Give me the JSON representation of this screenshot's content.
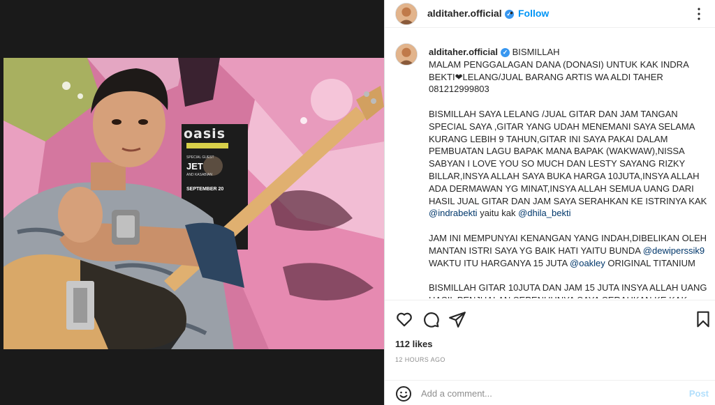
{
  "post": {
    "username": "alditaher.official",
    "verified_icon": "verified-badge-icon",
    "separator": "•",
    "follow_label": "Follow",
    "more_icon": "more-options-icon"
  },
  "media": {
    "poster_band": "oasis",
    "poster_small_1": "SPECIAL GUEST",
    "poster_act": "JET",
    "poster_small_2": "AND KASABIAN",
    "poster_date": "SEPTEMBER 20"
  },
  "caption": {
    "username": "alditaher.official",
    "paragraphs": [
      "BISMILLAH\nMALAM PENGGALAGAN DANA (DONASI) UNTUK KAK INDRA BEKTI❤LELANG/JUAL BARANG ARTIS WA ALDI TAHER 081212999803",
      "BISMILLAH SAYA LELANG /JUAL GITAR DAN JAM TANGAN SPECIAL SAYA ,GITAR YANG UDAH MENEMANI SAYA SELAMA KURANG LEBIH 9 TAHUN,GITAR INI SAYA PAKAI DALAM PEMBUATAN LAGU BAPAK MANA BAPAK (WAKWAW),NISSA SABYAN I LOVE YOU SO MUCH DAN LESTY SAYANG RIZKY BILLAR,INSYA ALLAH SAYA BUKA HARGA 10JUTA,INSYA ALLAH ADA DERMAWAN YG MINAT,INSYA ALLAH SEMUA UANG DARI HASIL JUAL GITAR DAN JAM SAYA SERAHKAN KE ISTRINYA KAK",
      "JAM INI MEMPUNYAI KENANGAN YANG INDAH,DIBELIKAN OLEH MANTAN ISTRI SAYA YG BAIK HATI YAITU BUNDA",
      "BISMILLAH GITAR 10JUTA DAN JAM 15 JUTA INSYA ALLAH UANG HASIL PENJUALAN SEPENUHNYA SAYA SERAHKAN KE KAK"
    ],
    "mention_1": "@indrabekti",
    "joiner_1": " yaitu kak ",
    "mention_2": "@dhila_bekti",
    "mention_3": "@dewiperssik9",
    "after_mention_3": "\nWAKTU ITU HARGANYA 15 JUTA ",
    "mention_4": "@oakley",
    "after_mention_4": " ORIGINAL TITANIUM"
  },
  "actions": {
    "like_icon": "heart-icon",
    "comment_icon": "comment-icon",
    "share_icon": "share-icon",
    "save_icon": "bookmark-icon"
  },
  "likes": "112 likes",
  "timestamp": "12 HOURS AGO",
  "comment": {
    "emoji_icon": "emoji-icon",
    "placeholder": "Add a comment...",
    "post_label": "Post"
  },
  "colors": {
    "link_blue": "#0095f6",
    "mention": "#00376b",
    "post_disabled": "#b2dffc",
    "verified": "#3897f0"
  }
}
